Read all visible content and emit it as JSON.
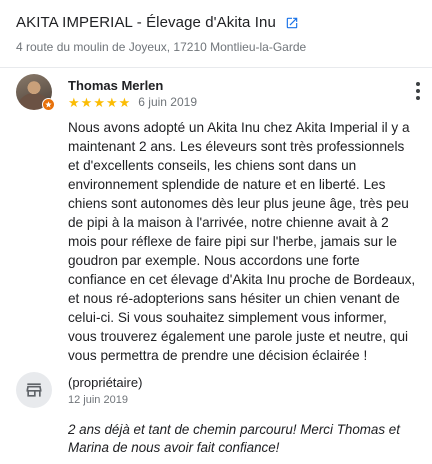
{
  "place": {
    "title": "AKITA IMPERIAL - Élevage d'Akita Inu",
    "address": "4 route du moulin de Joyeux, 17210 Montlieu-la-Garde",
    "link_icon": "open-in-new-icon"
  },
  "review": {
    "reviewer_name": "Thomas Merlen",
    "rating": 5,
    "rating_max": 5,
    "date": "6 juin 2019",
    "text": "Nous avons adopté un Akita Inu chez Akita Imperial il y a maintenant 2 ans. Les éleveurs sont très professionnels et d'excellents conseils, les chiens sont dans un environnement splendide de nature et en liberté. Les chiens sont autonomes dès leur plus jeune âge, très peu de pipi à la maison à l'arrivée, notre chienne avait à 2 mois pour réflexe de faire pipi sur l'herbe, jamais sur le goudron par exemple. Nous accordons une forte confiance en cet élevage d'Akita Inu proche de Bordeaux, et nous ré-adopterions sans hésiter un chien venant de celui-ci. Si vous souhaitez simplement vous informer, vous trouverez également une parole juste et neutre, qui vous permettra de prendre une décision éclairée !",
    "menu_icon": "more-vert-icon"
  },
  "owner_reply": {
    "label": "(propriétaire)",
    "date": "12 juin 2019",
    "text": "2 ans déjà et tant de chemin parcouru! Merci Thomas et Marina de nous avoir fait confiance!",
    "icon": "storefront-icon"
  },
  "colors": {
    "star": "#fbbc04",
    "link": "#1a73e8",
    "badge": "#e8710a",
    "secondary_text": "#70757a"
  }
}
